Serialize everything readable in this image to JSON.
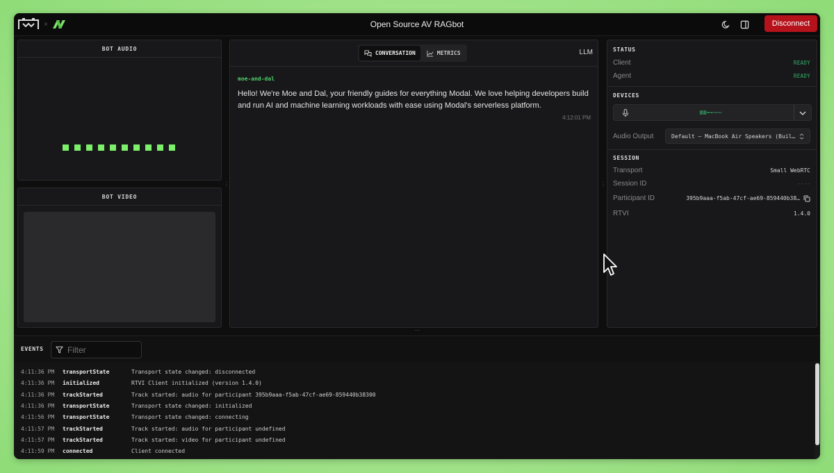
{
  "header": {
    "title": "Open Source AV RAGbot",
    "logo_sep": "×",
    "disconnect_label": "Disconnect"
  },
  "bot_audio": {
    "title": "BOT AUDIO"
  },
  "bot_video": {
    "title": "BOT VIDEO"
  },
  "conversation": {
    "tabs": [
      {
        "label": "CONVERSATION",
        "icon": "chat-icon",
        "active": true
      },
      {
        "label": "METRICS",
        "icon": "chart-icon",
        "active": false
      }
    ],
    "llm_label": "LLM",
    "messages": [
      {
        "sender": "moe-and-dal",
        "text": "Hello! We're Moe and Dal, your friendly guides for everything Modal. We love helping developers build and run AI and machine learning workloads with ease using Modal's serverless platform.",
        "time": "4:12:01 PM"
      }
    ]
  },
  "status": {
    "title": "STATUS",
    "client_label": "Client",
    "client_value": "READY",
    "agent_label": "Agent",
    "agent_value": "READY"
  },
  "devices": {
    "title": "DEVICES",
    "mic_icon": "mic-icon",
    "mic_level": 0.55,
    "audio_output_label": "Audio Output",
    "audio_output_value": "Default – MacBook Air Speakers (Buil…"
  },
  "session": {
    "title": "SESSION",
    "transport_label": "Transport",
    "transport_value": "Small WebRTC",
    "session_id_label": "Session ID",
    "session_id_value": "----",
    "participant_label": "Participant ID",
    "participant_value": "395b9aaa-f5ab-47cf-ae69-859440b38…",
    "rtvi_label": "RTVI",
    "rtvi_value": "1.4.0"
  },
  "events": {
    "title": "EVENTS",
    "filter_placeholder": "Filter",
    "rows": [
      {
        "time": "4:11:36 PM",
        "type": "transportState",
        "msg": "Transport state changed: disconnected"
      },
      {
        "time": "4:11:36 PM",
        "type": "initialized",
        "msg": "RTVI Client initialized (version 1.4.0)"
      },
      {
        "time": "4:11:36 PM",
        "type": "trackStarted",
        "msg": "Track started: audio for participant 395b9aaa-f5ab-47cf-ae69-859440b38300"
      },
      {
        "time": "4:11:36 PM",
        "type": "transportState",
        "msg": "Transport state changed: initialized"
      },
      {
        "time": "4:11:56 PM",
        "type": "transportState",
        "msg": "Transport state changed: connecting"
      },
      {
        "time": "4:11:57 PM",
        "type": "trackStarted",
        "msg": "Track started: audio for participant undefined"
      },
      {
        "time": "4:11:57 PM",
        "type": "trackStarted",
        "msg": "Track started: video for participant undefined"
      },
      {
        "time": "4:11:59 PM",
        "type": "connected",
        "msg": "Client connected"
      }
    ]
  },
  "colors": {
    "accent_green": "#33b36b",
    "audio_bar_green": "#7cf06a",
    "disconnect_red": "#b5121b"
  }
}
